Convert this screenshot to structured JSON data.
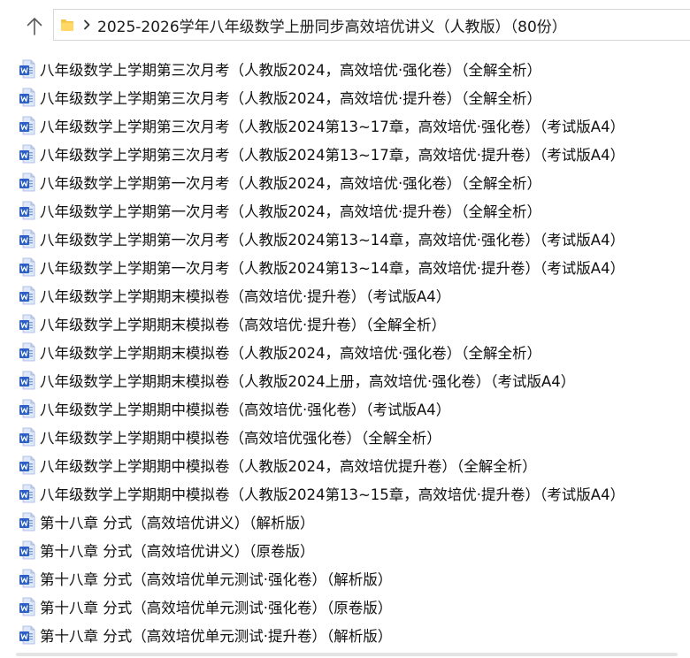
{
  "address": {
    "path": "2025-2026学年八年级数学上册同步高效培优讲义（人教版）（80份）"
  },
  "icons": {
    "up": "arrow-up-icon",
    "folder": "folder-icon",
    "chevron": "chevron-right-icon",
    "file": "word-document-icon"
  },
  "colors": {
    "folder": "#f4c542",
    "word_blue": "#2b5fc4",
    "word_light": "#dfe8f8"
  },
  "files": [
    {
      "name": "八年级数学上学期第三次月考（人教版2024，高效培优·强化卷）（全解全析）"
    },
    {
      "name": "八年级数学上学期第三次月考（人教版2024，高效培优·提升卷）（全解全析）"
    },
    {
      "name": "八年级数学上学期第三次月考（人教版2024第13~17章，高效培优·强化卷）（考试版A4）"
    },
    {
      "name": "八年级数学上学期第三次月考（人教版2024第13~17章，高效培优·提升卷）（考试版A4）"
    },
    {
      "name": "八年级数学上学期第一次月考（人教版2024，高效培优·强化卷）（全解全析）"
    },
    {
      "name": "八年级数学上学期第一次月考（人教版2024，高效培优·提升卷）（全解全析）"
    },
    {
      "name": "八年级数学上学期第一次月考（人教版2024第13~14章，高效培优·强化卷）（考试版A4）"
    },
    {
      "name": "八年级数学上学期第一次月考（人教版2024第13~14章，高效培优·提升卷）（考试版A4）"
    },
    {
      "name": "八年级数学上学期期末模拟卷（高效培优·提升卷）（考试版A4）"
    },
    {
      "name": "八年级数学上学期期末模拟卷（高效培优·提升卷）（全解全析）"
    },
    {
      "name": "八年级数学上学期期末模拟卷（人教版2024，高效培优·强化卷）（全解全析）"
    },
    {
      "name": "八年级数学上学期期末模拟卷（人教版2024上册，高效培优·强化卷）（考试版A4）"
    },
    {
      "name": "八年级数学上学期期中模拟卷（高效培优·强化卷）（考试版A4）"
    },
    {
      "name": "八年级数学上学期期中模拟卷（高效培优强化卷）（全解全析）"
    },
    {
      "name": "八年级数学上学期期中模拟卷（人教版2024，高效培优提升卷）（全解全析）"
    },
    {
      "name": "八年级数学上学期期中模拟卷（人教版2024第13~15章，高效培优·提升卷）（考试版A4）"
    },
    {
      "name": "第十八章  分式（高效培优讲义）（解析版）"
    },
    {
      "name": "第十八章  分式（高效培优讲义）（原卷版）"
    },
    {
      "name": "第十八章 分式（高效培优单元测试·强化卷）（解析版）"
    },
    {
      "name": "第十八章 分式（高效培优单元测试·强化卷）（原卷版）"
    },
    {
      "name": "第十八章 分式（高效培优单元测试·提升卷）（解析版）"
    }
  ]
}
